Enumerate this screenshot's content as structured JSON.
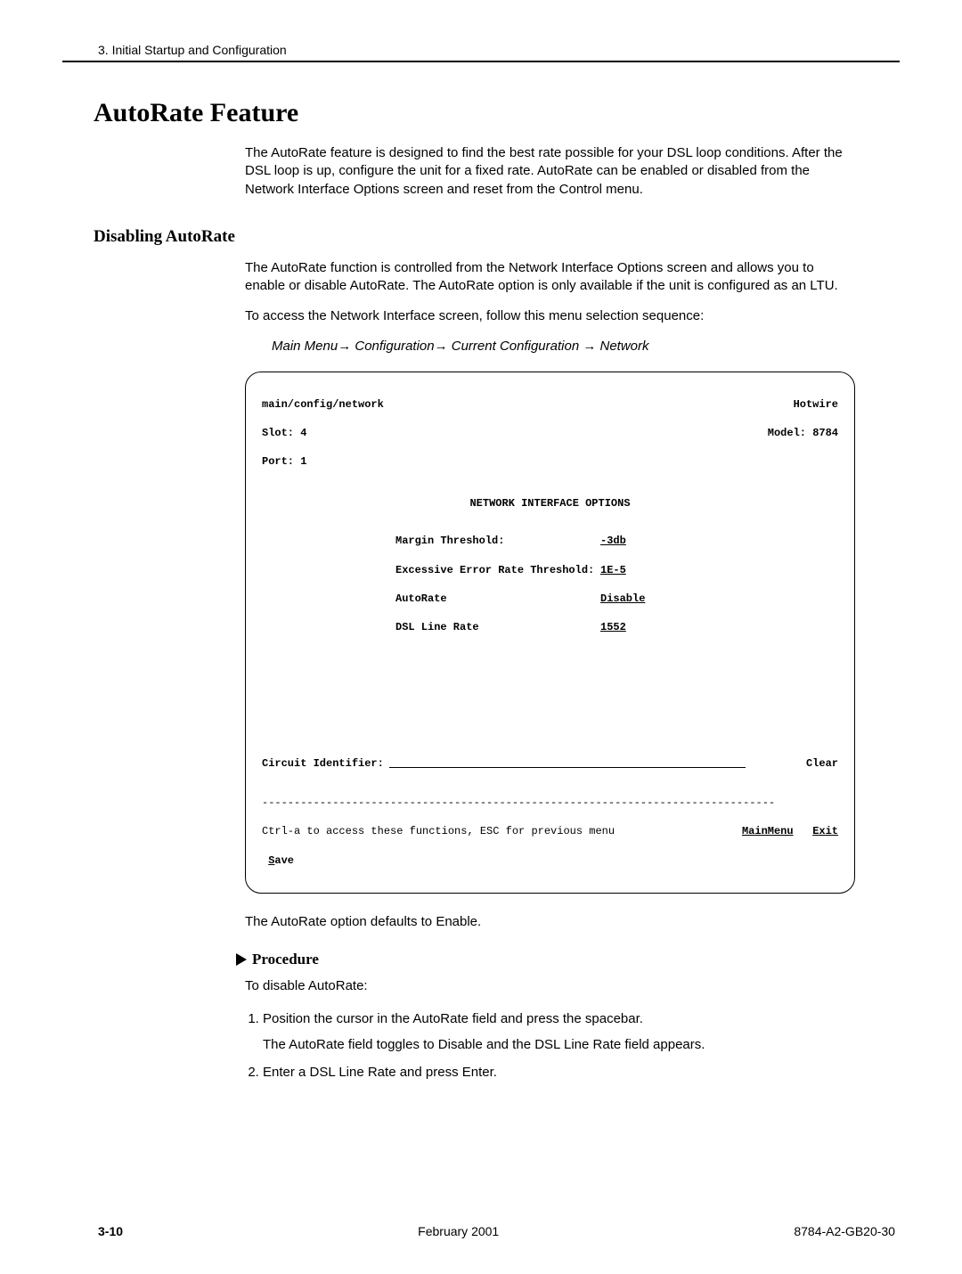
{
  "header": {
    "chapter": "3. Initial Startup and Configuration"
  },
  "heading1": "AutoRate Feature",
  "intro": "The AutoRate feature is designed to find the best rate possible for your DSL loop conditions. After the DSL loop is up, configure the unit for a fixed rate. AutoRate can be enabled or disabled from the Network Interface Options screen and reset from the Control menu.",
  "heading2": "Disabling AutoRate",
  "p1": "The AutoRate function is controlled from the Network Interface Options screen and allows you to enable or disable AutoRate. The AutoRate option is only available if the unit is configured as an LTU.",
  "p2": "To access the Network Interface screen, follow this menu selection sequence:",
  "menupath": "Main Menu→ Configuration→ Current Configuration → Network",
  "term": {
    "path": "main/config/network",
    "brand": "Hotwire",
    "slot_l": "Slot: 4",
    "model": "Model: 8784",
    "port": "Port: 1",
    "title": "NETWORK INTERFACE OPTIONS",
    "opts": [
      {
        "label": "Margin Threshold:",
        "value": "-3db"
      },
      {
        "label": "Excessive Error Rate Threshold:",
        "value": "1E-5"
      },
      {
        "label": "AutoRate",
        "value": "Disable"
      },
      {
        "label": "DSL Line Rate",
        "value": "1552"
      }
    ],
    "circuit_label": "Circuit Identifier:",
    "clear": "Clear",
    "dashes": "--------------------------------------------------------------------------------",
    "ctrl_text": "Ctrl-a to access these functions, ESC for previous menu",
    "mainmenu": "MainMenu",
    "exit": "Exit",
    "save_s": "S",
    "save_rest": "ave"
  },
  "after_term": "The AutoRate option defaults to Enable.",
  "procedure_label": "Procedure",
  "proc_intro": "To disable AutoRate:",
  "steps": {
    "s1": "Position the cursor in the AutoRate field and press the spacebar.",
    "s1b": "The AutoRate field toggles to Disable and the DSL Line Rate field appears.",
    "s2": "Enter a DSL Line Rate and press Enter."
  },
  "footer": {
    "page": "3-10",
    "date": "February 2001",
    "doc": "8784-A2-GB20-30"
  }
}
